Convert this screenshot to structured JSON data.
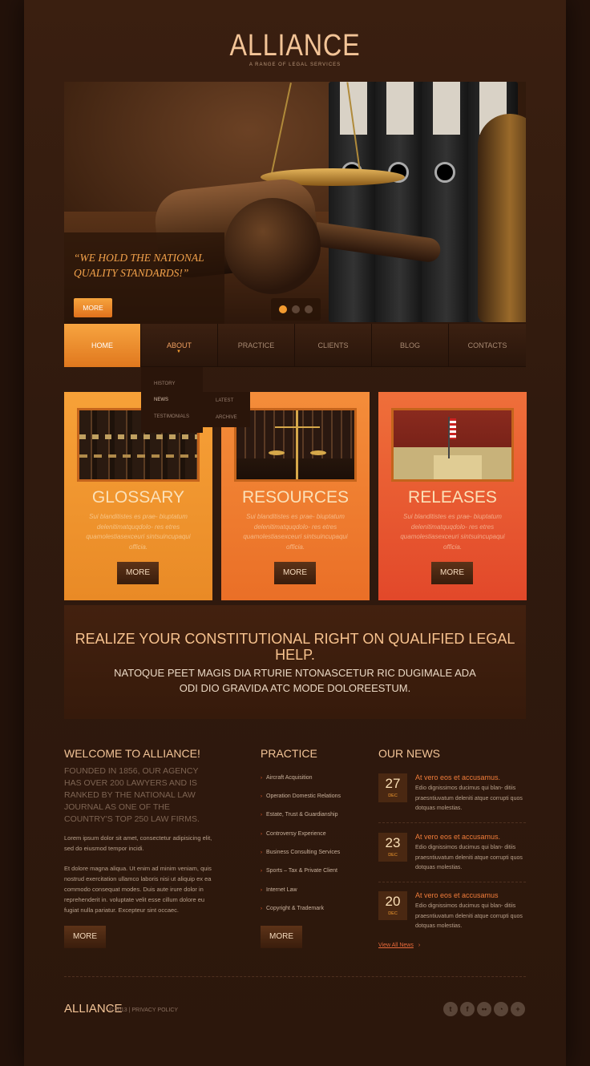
{
  "header": {
    "logo": "ALLIANCE",
    "tagline": "A RANGE OF LEGAL SERVICES"
  },
  "hero": {
    "quote": "“WE HOLD THE NATIONAL QUALITY STANDARDS!”",
    "button": "MORE",
    "slides_total": 3,
    "slide_active": 1
  },
  "nav": {
    "items": [
      "HOME",
      "ABOUT",
      "PRACTICE",
      "CLIENTS",
      "BLOG",
      "CONTACTS"
    ],
    "active": "HOME",
    "submenu": [
      "HISTORY",
      "NEWS",
      "TESTIMONIALS"
    ],
    "submenu_news": [
      "LATEST",
      "ARCHIVE"
    ]
  },
  "cards": [
    {
      "title": "GLOSSARY",
      "text": "Sui blanditistes es prae- biuptatum delenitimatquqdolo- res etres quamolestiasexceuri sintsuincupaqui officia.",
      "button": "MORE"
    },
    {
      "title": "RESOURCES",
      "text": "Sui blanditistes es prae- biuptatum delenitimatquqdolo- res etres quamolestiasexceuri sintsuincupaqui officia.",
      "button": "MORE"
    },
    {
      "title": "RELEASES",
      "text": "Sui blanditistes es prae- biuptatum delenitimatquqdolo- res etres quamolestiasexceuri sintsuincupaqui officia.",
      "button": "MORE"
    }
  ],
  "banner": {
    "heading": "REALIZE YOUR CONSTITUTIONAL RIGHT ON QUALIFIED LEGAL HELP.",
    "subheading": "NATOQUE PEET MAGIS DIA RTURIE NTONASCETUR RIC DUGIMALE ADA ODI DIO GRAVIDA ATC MODE DOLOREESTUM."
  },
  "welcome": {
    "heading": "WELCOME  TO ALLIANCE!",
    "sub": "FOUNDED IN 1856, OUR AGENCY HAS OVER 200 LAWYERS AND IS RANKED BY THE NATIONAL LAW JOURNAL AS ONE OF THE COUNTRY'S TOP 250 LAW FIRMS.",
    "p1": "Lorem ipsum dolor sit amet, consectetur adipisicing elit, sed do eiusmod tempor incidi.",
    "p2": "Et dolore magna aliqua. Ut enim ad minim veniam, quis nostrud exercitation ullamco laboris nisi ut aliquip ex ea commodo consequat modes.  Duis aute irure dolor in reprehenderit in. voluptate velit esse cillum dolore eu fugiat nulla pariatur.  Excepteur sint occaec.",
    "button": "MORE"
  },
  "practice": {
    "heading": "PRACTICE",
    "items": [
      "Aircraft Acquisition",
      "Operation Domestic Relations",
      "Estate, Trust & Guardianship",
      "Controversy Experience",
      "Business Consulting Services",
      "Sports – Tax & Private Client",
      "Internet Law",
      "Copyright & Trademark"
    ],
    "button": "MORE"
  },
  "news": {
    "heading": "OUR NEWS",
    "items": [
      {
        "day": "27",
        "month": "DEC",
        "title": "At vero eos et accusamus.",
        "text": "Edio dignissimos ducimus qui blan- ditiis praesntiuvatum deleniti atque corrupti quos dotquas molestias."
      },
      {
        "day": "23",
        "month": "DEC",
        "title": "At vero eos et accusamus.",
        "text": "Edio dignissimos ducimus qui blan- ditiis praesntiuvatum deleniti atque corrupti quos dotquas molestias."
      },
      {
        "day": "20",
        "month": "DEC",
        "title": "At vero eos et accusamus",
        "text": "Edio dignissimos ducimus qui blan- ditiis praesntiuvatum deleniti atque corrupti quos dotquas molestias."
      }
    ],
    "view_all": "View All News"
  },
  "footer": {
    "logo": "ALLIANCE",
    "copy": "© 2013 | PRIVACY POLICY",
    "social": [
      "twitter-icon",
      "facebook-icon",
      "flickr-icon",
      "rss-icon",
      "plus-icon"
    ]
  },
  "colors": {
    "accent": "#f39b30",
    "background": "#2a160c",
    "card1": "#f7a138",
    "card2": "#f48d3a",
    "card3": "#ef6f3a"
  }
}
